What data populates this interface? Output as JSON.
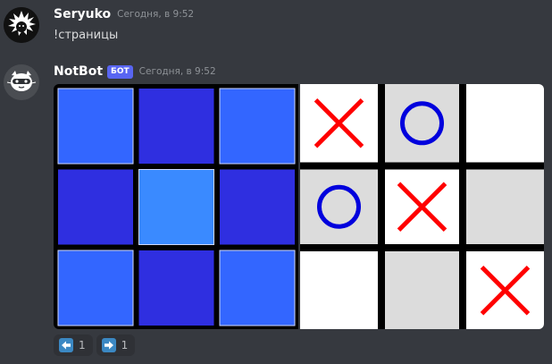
{
  "messages": [
    {
      "author": "Seryuko",
      "time": "Сегодня, в 9:52",
      "text": "!страницы",
      "avatar_icon": "spiky-hair-avatar-icon"
    },
    {
      "author": "NotBot",
      "bot_tag": "БОТ",
      "time": "Сегодня, в 9:52",
      "avatar_icon": "cat-robot-avatar-icon",
      "color_grid": [
        [
          "#3366ff",
          "#2f2fe0",
          "#3366ff"
        ],
        [
          "#2f2fe0",
          "#3a8aff",
          "#2f2fe0"
        ],
        [
          "#3366ff",
          "#2f2fe0",
          "#3366ff"
        ]
      ],
      "tictactoe": [
        [
          "X",
          "O",
          ""
        ],
        [
          "O",
          "X",
          ""
        ],
        [
          "",
          "",
          "X"
        ]
      ],
      "tictactoe_shaded": [
        [
          false,
          true,
          false
        ],
        [
          true,
          false,
          true
        ],
        [
          false,
          true,
          false
        ]
      ],
      "reactions": [
        {
          "icon": "arrow-left-icon",
          "count": "1"
        },
        {
          "icon": "arrow-right-icon",
          "count": "1"
        }
      ]
    }
  ],
  "colors": {
    "background": "#36393f",
    "x_mark": "#ff0000",
    "o_mark": "#0000dd",
    "bot_tag": "#5865f2"
  }
}
